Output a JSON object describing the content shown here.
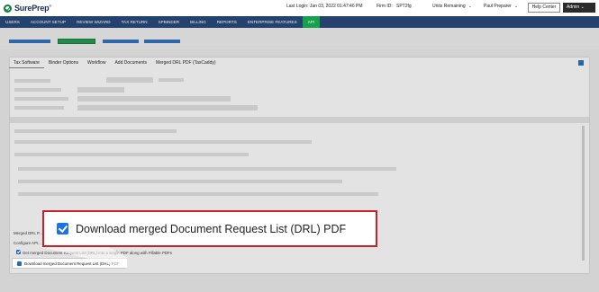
{
  "header": {
    "brand": "SurePrep",
    "last_login": "Last Login: Jan 03, 2022 01:47:46 PM",
    "firm_id": "Firm ID:",
    "firm_id_value": "SPT2fg",
    "units_remaining": "Units Remaining",
    "user": "Paul Preparer",
    "help_center": "Help Center",
    "admin": "Admin"
  },
  "nav": {
    "items": [
      "USERS",
      "ACCOUNT SETUP",
      "REVIEW WIZARD",
      "TAX RETURN",
      "SPBINDER",
      "BILLING",
      "REPORTS",
      "ENTERPRISE FEATURES",
      "API"
    ]
  },
  "tabs": [
    "Tax Software",
    "Binder Options",
    "Workflow",
    "Add Documents",
    "Merged DRL PDF (TaxCaddy)"
  ],
  "bottom": {
    "section_title": "Merged DRL P...",
    "configure": "Configure API...",
    "option1": "Get merged Document Request List (DRL) into a single PDF along with Fillable PDFs",
    "option2": "Download merged Document Request List (DRL) PDF"
  },
  "callout": {
    "label": "Download merged Document Request List (DRL) PDF"
  },
  "colors": {
    "nav_bg": "#25426e",
    "nav_active": "#18a14d",
    "callout_border": "#c8202a",
    "checkbox": "#1a73e8"
  }
}
